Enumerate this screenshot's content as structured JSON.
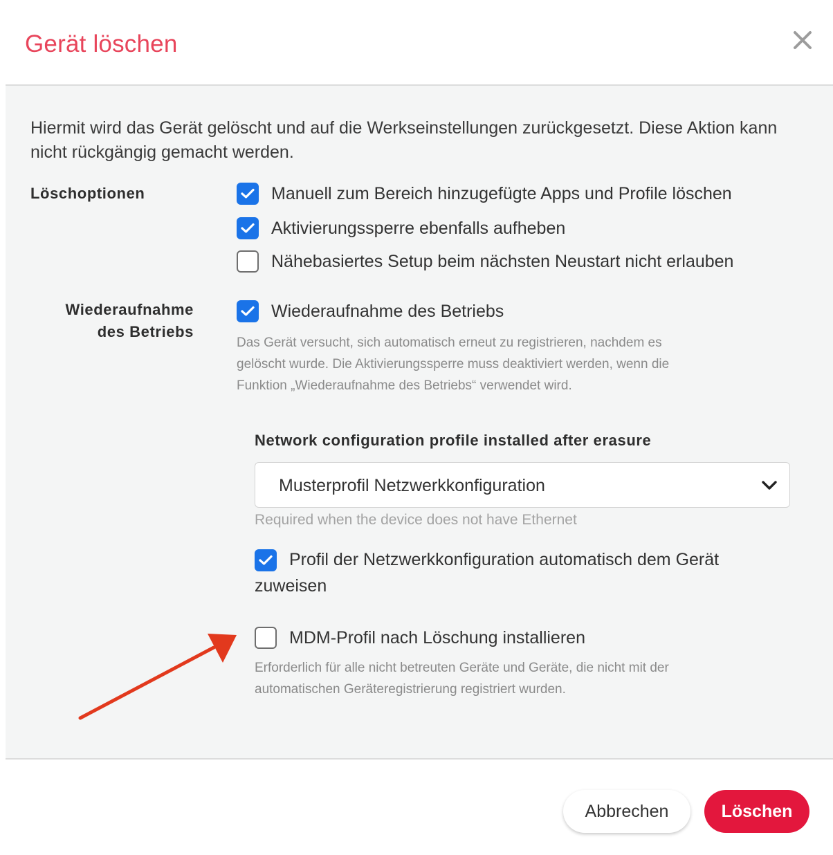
{
  "dialog": {
    "title": "Gerät löschen",
    "close_icon": "close-icon"
  },
  "intro_text": "Hiermit wird das Gerät gelöscht und auf die Werkseinstellungen zurückgesetzt. Diese Aktion kann nicht rückgängig gemacht werden.",
  "erase_options": {
    "label": "Löschoptionen",
    "items": [
      {
        "label": "Manuell zum Bereich hinzugefügte Apps und Profile löschen",
        "checked": true
      },
      {
        "label": "Aktivierungssperre ebenfalls aufheben",
        "checked": true
      },
      {
        "label": "Nähebasiertes Setup beim nächsten Neustart nicht erlauben",
        "checked": false
      }
    ]
  },
  "return_to_service": {
    "label_line1": "Wiederaufnahme",
    "label_line2": "des Betriebs",
    "checkbox_label": "Wiederaufnahme des Betriebs",
    "checked": true,
    "helper_line1": "Das Gerät versucht, sich automatisch erneut zu registrieren, nachdem es",
    "helper_line2": "gelöscht wurde. Die Aktivierungssperre muss deaktiviert werden, wenn die",
    "helper_line3": "Funktion „Wiederaufnahme des Betriebs“ verwendet wird."
  },
  "network_profile": {
    "label": "Network configuration profile installed after erasure",
    "selected_value": "Musterprofil Netzwerkkonfiguration",
    "helper": "Required when the device does not have Ethernet",
    "assign_checkbox_line1": "Profil der Netzwerkkonfiguration automatisch dem Gerät",
    "assign_checkbox_line2": "zuweisen",
    "assign_checked": true
  },
  "mdm_profile": {
    "checkbox_label": "MDM-Profil nach Löschung installieren",
    "checked": false,
    "helper_line1": "Erforderlich für alle nicht betreuten Geräte und Geräte, die nicht mit der",
    "helper_line2": "automatischen Geräteregistrierung registriert wurden."
  },
  "footer": {
    "cancel_label": "Abbrechen",
    "delete_label": "Löschen"
  },
  "colors": {
    "title": "#e8455b",
    "checkbox": "#1a73e8",
    "delete_button": "#e3173d",
    "arrow": "#e2391d"
  }
}
